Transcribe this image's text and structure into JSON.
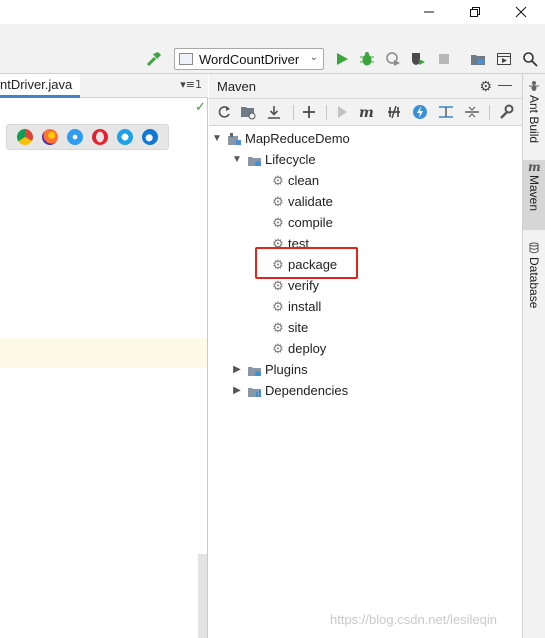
{
  "toolbar": {
    "run_config": "WordCountDriver"
  },
  "editor": {
    "tab_label": "ntDriver.java",
    "tab_menu": "▾≡1",
    "browsers": [
      "chrome-icon",
      "firefox-icon",
      "safari-icon",
      "opera-icon",
      "ie-icon",
      "edge-icon"
    ]
  },
  "maven": {
    "title": "Maven",
    "project": "MapReduceDemo",
    "lifecycle_label": "Lifecycle",
    "lifecycle": [
      "clean",
      "validate",
      "compile",
      "test",
      "package",
      "verify",
      "install",
      "site",
      "deploy"
    ],
    "plugins_label": "Plugins",
    "dependencies_label": "Dependencies",
    "highlighted": "package"
  },
  "stripe": {
    "ant_build": "Ant Build",
    "maven": "Maven",
    "database": "Database"
  },
  "watermark": "https://blog.csdn.net/lesileqin",
  "colors": {
    "run_green": "#3aa53a",
    "highlight_red": "#e0261c",
    "tab_underline": "#4083c9",
    "caret_line": "#fdfae8"
  }
}
